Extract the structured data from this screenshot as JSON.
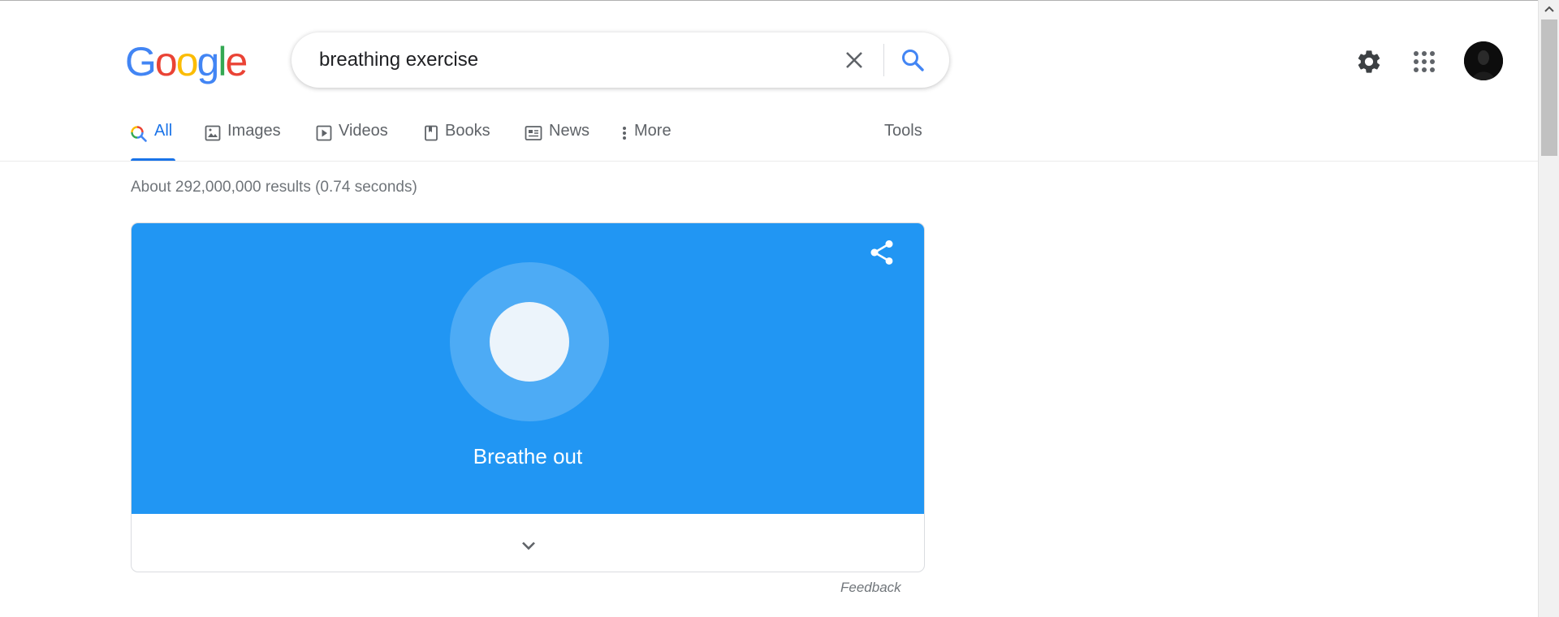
{
  "logo": {
    "letters": [
      "G",
      "o",
      "o",
      "g",
      "l",
      "e"
    ],
    "colors": [
      "#4285f4",
      "#ea4335",
      "#fbbc05",
      "#4285f4",
      "#34a853",
      "#ea4335"
    ]
  },
  "search": {
    "query": "breathing exercise",
    "clear_icon": "close-icon",
    "search_icon": "search-icon"
  },
  "header_icons": [
    "gear-icon",
    "apps-grid-icon",
    "avatar"
  ],
  "tabs": [
    {
      "label": "All",
      "icon": "search-multicolor-icon",
      "active": true
    },
    {
      "label": "Images",
      "icon": "image-icon",
      "active": false
    },
    {
      "label": "Videos",
      "icon": "play-icon",
      "active": false
    },
    {
      "label": "Books",
      "icon": "book-icon",
      "active": false
    },
    {
      "label": "News",
      "icon": "news-icon",
      "active": false
    },
    {
      "label": "More",
      "icon": "more-vert-icon",
      "active": false
    }
  ],
  "tools_label": "Tools",
  "result_stats": "About 292,000,000 results (0.74 seconds)",
  "breathing_card": {
    "label": "Breathe out",
    "background_color": "#2196f3",
    "share_icon": "share-icon",
    "expand_icon": "chevron-down-icon"
  },
  "feedback_label": "Feedback",
  "colors": {
    "accent": "#1a73e8",
    "text_secondary": "#5f6368",
    "stats": "#70757a"
  }
}
